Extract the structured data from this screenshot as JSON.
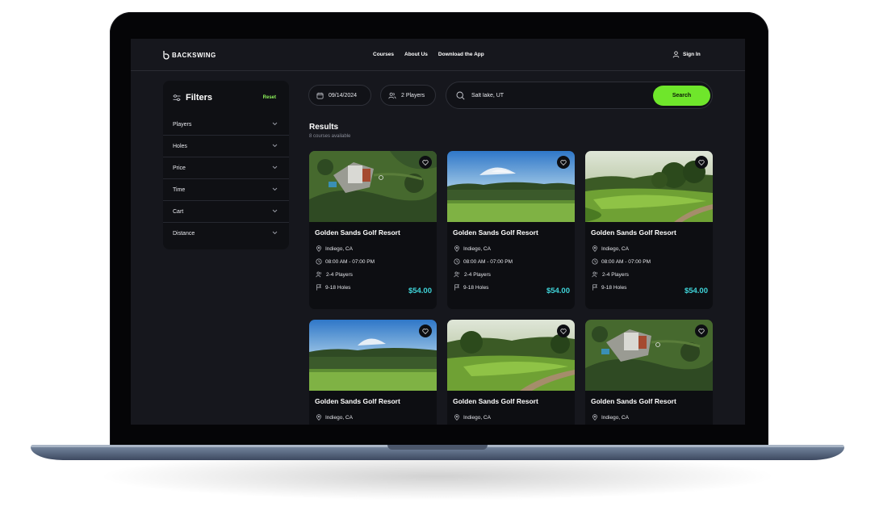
{
  "brand": {
    "name": "BACKSWING"
  },
  "nav": {
    "links": [
      "Courses",
      "About Us",
      "Download the App"
    ],
    "signin": "Sign In"
  },
  "filters": {
    "title": "Filters",
    "reset": "Reset",
    "items": [
      "Players",
      "Holes",
      "Price",
      "Time",
      "Cart",
      "Distance"
    ]
  },
  "search": {
    "date": "09/14/2024",
    "players": "2 Players",
    "location": "Salt lake, UT",
    "button": "Search"
  },
  "results": {
    "title": "Results",
    "subtitle": "8 courses available",
    "cards": [
      {
        "name": "Golden Sands Golf Resort",
        "location": "Indiego, CA",
        "hours": "08:00 AM - 07:00 PM",
        "players": "2-4 Players",
        "holes": "9-18 Holes",
        "price": "$54.00",
        "image": "aerial"
      },
      {
        "name": "Golden Sands Golf Resort",
        "location": "Indiego, CA",
        "hours": "08:00 AM - 07:00 PM",
        "players": "2-4 Players",
        "holes": "9-18 Holes",
        "price": "$54.00",
        "image": "green"
      },
      {
        "name": "Golden Sands Golf Resort",
        "location": "Indiego, CA",
        "hours": "08:00 AM - 07:00 PM",
        "players": "2-4 Players",
        "holes": "9-18 Holes",
        "price": "$54.00",
        "image": "fairway"
      },
      {
        "name": "Golden Sands Golf Resort",
        "location": "Indiego, CA",
        "image": "green"
      },
      {
        "name": "Golden Sands Golf Resort",
        "location": "Indiego, CA",
        "image": "fairway"
      },
      {
        "name": "Golden Sands Golf Resort",
        "location": "Indiego, CA",
        "image": "aerial"
      }
    ]
  },
  "colors": {
    "accent": "#6fe62b",
    "price": "#3fd4d9",
    "background": "#16171d",
    "card": "#0d0e12"
  },
  "icons": [
    "calendar-icon",
    "users-icon",
    "search-icon",
    "heart-icon",
    "map-pin-icon",
    "clock-icon",
    "flag-icon",
    "user-icon",
    "sliders-icon",
    "chevron-down-icon"
  ]
}
